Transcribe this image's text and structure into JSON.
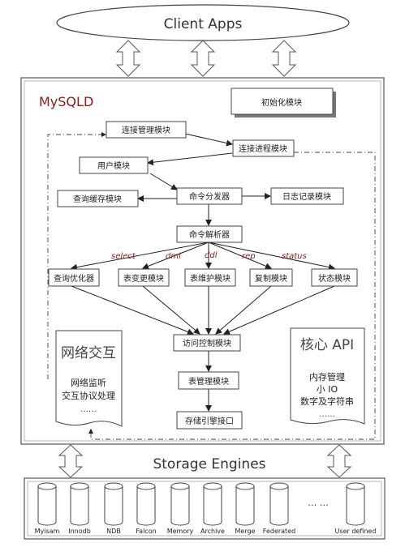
{
  "client": {
    "label": "Client Apps"
  },
  "mysqld": {
    "title": "MySQLD",
    "modules": {
      "init": "初始化模块",
      "conn_mgmt": "连接管理模块",
      "conn_thread": "连接进程模块",
      "user": "用户模块",
      "query_cache": "查询缓存模块",
      "cmd_dispatch": "命令分发器",
      "log": "日志记录模块",
      "cmd_parser": "命令解析器",
      "optimizer": "查询优化器",
      "table_change": "表变更模块",
      "table_maint": "表维护模块",
      "replication": "复制模块",
      "status": "状态模块",
      "access_ctrl": "访问控制模块",
      "table_mgmt": "表管理模块",
      "storage_if": "存储引擎接口"
    },
    "branch_labels": {
      "select": "select",
      "dml": "dml",
      "ddl": "ddl",
      "rep": "rep",
      "status": "status"
    },
    "network": {
      "title": "网络交互",
      "line1": "网络监听",
      "line2": "交互协议处理",
      "ellipsis": "……"
    },
    "core_api": {
      "title": "核心 API",
      "line1": "内存管理",
      "line2": "小 IO",
      "line3": "数字及字符串",
      "ellipsis": "……"
    }
  },
  "storage": {
    "title": "Storage Engines",
    "engines": [
      "Myisam",
      "Innodb",
      "NDB",
      "Falcon",
      "Memory",
      "Archive",
      "Merge",
      "Federated",
      "User defined"
    ],
    "ellipsis": "… …"
  }
}
